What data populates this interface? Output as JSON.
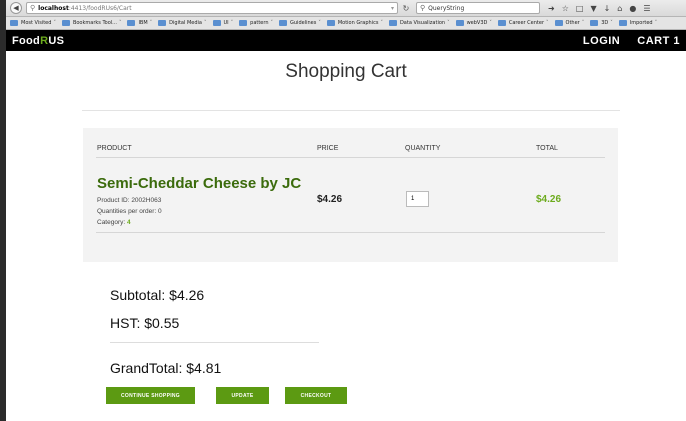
{
  "browser": {
    "url_host": "localhost",
    "url_path": ":4413/foodRUs6/Cart",
    "search_value": "QueryString",
    "bookmarks": [
      {
        "label": "Most Visited"
      },
      {
        "label": "Bookmarks Tool..."
      },
      {
        "label": "IBM"
      },
      {
        "label": "Digital Media"
      },
      {
        "label": "UI"
      },
      {
        "label": "pattern"
      },
      {
        "label": "Guidelines"
      },
      {
        "label": "Motion Graphics"
      },
      {
        "label": "Data Visualization"
      },
      {
        "label": "webV3D"
      },
      {
        "label": "Career Center"
      },
      {
        "label": "Other"
      },
      {
        "label": "3D"
      },
      {
        "label": "Imported"
      }
    ]
  },
  "site": {
    "logo_prefix": "Food",
    "logo_r": "R",
    "logo_suffix": "US",
    "login": "LOGIN",
    "cart": "CART 1",
    "accent": "#6dab1e"
  },
  "page": {
    "title": "Shopping Cart"
  },
  "cart": {
    "headers": {
      "product": "PRODUCT",
      "price": "PRICE",
      "quantity": "QUANTITY",
      "total": "TOTAL"
    },
    "item": {
      "name": "Semi-Cheddar Cheese by JC",
      "product_id": "Product ID: 2002H063",
      "quantities": "Quantities per order: 0",
      "category_label": "Category:",
      "category_value": "4",
      "price": "$4.26",
      "quantity": "1",
      "total": "$4.26"
    }
  },
  "summary": {
    "subtotal": "Subtotal: $4.26",
    "hst": "HST: $0.55",
    "grand_total": "GrandTotal: $4.81"
  },
  "buttons": {
    "continue": "CONTINUE SHOPPING",
    "update": "UPDATE",
    "checkout": "CHECKOUT"
  }
}
